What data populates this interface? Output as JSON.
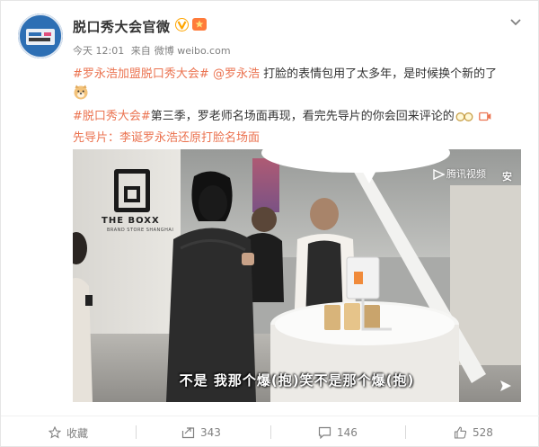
{
  "account": {
    "name": "脱口秀大会官微"
  },
  "post": {
    "time": "今天 12:01",
    "source_prefix": "来自",
    "source": "微博 weibo.com",
    "line1_tag1": "#罗永浩加盟脱口秀大会#",
    "line1_mention": "@罗永浩",
    "line1_text": " 打脸的表情包用了太多年，是时候换个新的了",
    "line2_tag": "#脱口秀大会#",
    "line2_text": "第三季，罗老师名场面再现，看完先导片的你会回来评论的",
    "line3_link": "先导片：李诞罗永浩还原打脸名场面"
  },
  "video": {
    "brand_text": "THE BOXX",
    "brand_sub": "BRAND STORE SHANGHAI",
    "watermark": "腾讯视频",
    "watermark_right": "安",
    "subtitle": "不是  我那个爆(抱)笑不是那个爆(抱)"
  },
  "actions": {
    "favorite": "收藏",
    "repost": "343",
    "comment": "146",
    "like": "528"
  },
  "colors": {
    "accent": "#eb7350",
    "verified": "#ffa500",
    "meta": "#808080"
  },
  "icons": [
    "verified-v-icon",
    "medal-icon",
    "chevron-down-icon",
    "doge-emoji-icon",
    "glasses-emoji-icon",
    "video-link-icon",
    "tencent-video-logo-icon",
    "share-icon",
    "star-icon",
    "repost-icon",
    "comment-icon",
    "thumbs-up-icon"
  ]
}
